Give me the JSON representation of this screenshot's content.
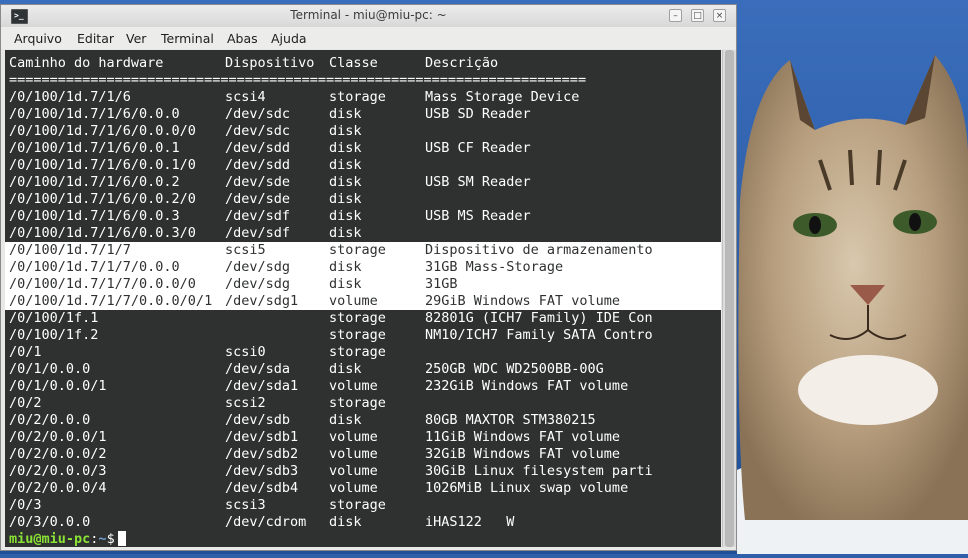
{
  "window": {
    "title": "Terminal - miu@miu-pc: ~",
    "app_icon_glyph": ">_",
    "buttons": {
      "minimize": "–",
      "maximize": "□",
      "close": "×"
    }
  },
  "menu": [
    "Arquivo",
    "Editar",
    "Ver",
    "Terminal",
    "Abas",
    "Ajuda"
  ],
  "terminal": {
    "headers": [
      "Caminho do hardware",
      "Dispositivo",
      "Classe",
      "Descrição"
    ],
    "separator": "=======================================================================",
    "rows": [
      [
        "/0/100/1d.7/1/6",
        "scsi4",
        "storage",
        "Mass Storage Device"
      ],
      [
        "/0/100/1d.7/1/6/0.0.0",
        "/dev/sdc",
        "disk",
        "USB SD Reader"
      ],
      [
        "/0/100/1d.7/1/6/0.0.0/0",
        "/dev/sdc",
        "disk",
        ""
      ],
      [
        "/0/100/1d.7/1/6/0.0.1",
        "/dev/sdd",
        "disk",
        "USB CF Reader"
      ],
      [
        "/0/100/1d.7/1/6/0.0.1/0",
        "/dev/sdd",
        "disk",
        ""
      ],
      [
        "/0/100/1d.7/1/6/0.0.2",
        "/dev/sde",
        "disk",
        "USB SM Reader"
      ],
      [
        "/0/100/1d.7/1/6/0.0.2/0",
        "/dev/sde",
        "disk",
        ""
      ],
      [
        "/0/100/1d.7/1/6/0.0.3",
        "/dev/sdf",
        "disk",
        "USB MS Reader"
      ],
      [
        "/0/100/1d.7/1/6/0.0.3/0",
        "/dev/sdf",
        "disk",
        ""
      ],
      [
        "/0/100/1d.7/1/7",
        "scsi5",
        "storage",
        "Dispositivo de armazenamento"
      ],
      [
        "/0/100/1d.7/1/7/0.0.0",
        "/dev/sdg",
        "disk",
        "31GB Mass-Storage"
      ],
      [
        "/0/100/1d.7/1/7/0.0.0/0",
        "/dev/sdg",
        "disk",
        "31GB"
      ],
      [
        "/0/100/1d.7/1/7/0.0.0/0/1",
        "/dev/sdg1",
        "volume",
        "29GiB Windows FAT volume"
      ],
      [
        "/0/100/1f.1",
        "",
        "storage",
        "82801G (ICH7 Family) IDE Con"
      ],
      [
        "/0/100/1f.2",
        "",
        "storage",
        "NM10/ICH7 Family SATA Contro"
      ],
      [
        "/0/1",
        "scsi0",
        "storage",
        ""
      ],
      [
        "/0/1/0.0.0",
        "/dev/sda",
        "disk",
        "250GB WDC WD2500BB-00G"
      ],
      [
        "/0/1/0.0.0/1",
        "/dev/sda1",
        "volume",
        "232GiB Windows FAT volume"
      ],
      [
        "/0/2",
        "scsi2",
        "storage",
        ""
      ],
      [
        "/0/2/0.0.0",
        "/dev/sdb",
        "disk",
        "80GB MAXTOR STM380215"
      ],
      [
        "/0/2/0.0.0/1",
        "/dev/sdb1",
        "volume",
        "11GiB Windows FAT volume"
      ],
      [
        "/0/2/0.0.0/2",
        "/dev/sdb2",
        "volume",
        "32GiB Windows FAT volume"
      ],
      [
        "/0/2/0.0.0/3",
        "/dev/sdb3",
        "volume",
        "30GiB Linux filesystem parti"
      ],
      [
        "/0/2/0.0.0/4",
        "/dev/sdb4",
        "volume",
        "1026MiB Linux swap volume"
      ],
      [
        "/0/3",
        "scsi3",
        "storage",
        ""
      ],
      [
        "/0/3/0.0.0",
        "/dev/cdrom",
        "disk",
        "iHAS122   W"
      ]
    ],
    "selected_rows": [
      9,
      10,
      11,
      12
    ],
    "prompt": {
      "user_host": "miu@miu-pc",
      "sep": ":",
      "path": "~",
      "symbol": "$"
    }
  },
  "colors": {
    "terminal_bg": "#2f3130",
    "terminal_fg": "#ffffff",
    "prompt_user": "#8ae234",
    "prompt_path": "#729fcf",
    "selection_bg": "#ffffff",
    "desktop_sky": "#2e5fa8"
  },
  "wallpaper": {
    "subject": "bobcat-wallpaper"
  }
}
